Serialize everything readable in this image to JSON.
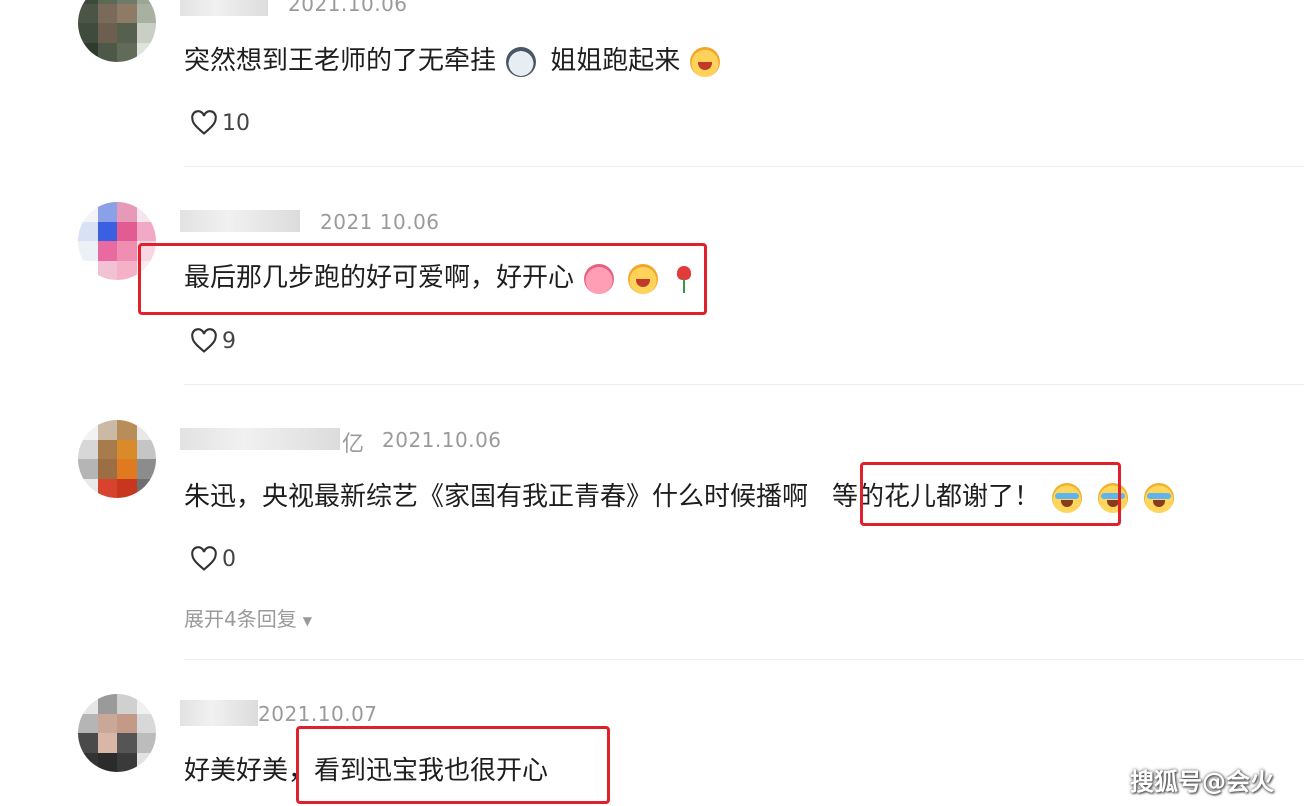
{
  "comments": [
    {
      "date": "2021.10.06",
      "text_before": "突然想到王老师的了无牵挂",
      "text_after": "姐姐跑起来",
      "likes": "10"
    },
    {
      "date": "2021 10.06",
      "text": "最后那几步跑的好可爱啊，好开心",
      "likes": "9"
    },
    {
      "name_suffix": "亿",
      "date": "2021.10.06",
      "text_before": "朱迅，央视最新综艺《家国有我正青春》什么时候播啊",
      "text_highlight": "等的花儿都谢了！",
      "likes": "0",
      "expand_replies": "展开4条回复"
    },
    {
      "date": "2021.10.07",
      "text_before": "好美好美",
      "text_highlight": "，看到迅宝我也很开心"
    }
  ],
  "watermark": "搜狐号@会火",
  "colors": {
    "highlight_box": "#e0202a",
    "date": "#9a9a9a",
    "divider": "#ececec"
  },
  "icons": {
    "like": "heart-outline-icon"
  }
}
